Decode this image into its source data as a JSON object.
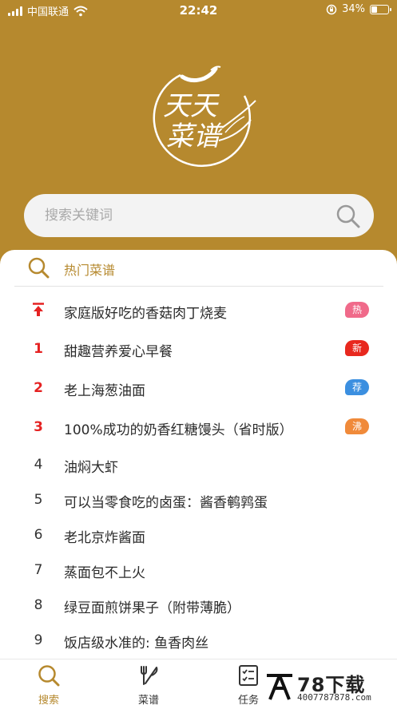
{
  "status_bar": {
    "carrier": "中国联通",
    "time": "22:42",
    "battery": "34%",
    "battery_level": 0.34
  },
  "logo": {
    "line1": "天天",
    "line2": "菜谱"
  },
  "search": {
    "placeholder": "搜索关键词",
    "icon": "search-icon"
  },
  "hot": {
    "title": "热门菜谱"
  },
  "recipes": [
    {
      "rank": "",
      "rank_icon": "pin-top-icon",
      "title": "家庭版好吃的香菇肉丁烧麦",
      "badge": "热",
      "badge_color": "#f06a8a"
    },
    {
      "rank": "1",
      "title": "甜趣营养爱心早餐",
      "badge": "新",
      "badge_color": "#e8281e"
    },
    {
      "rank": "2",
      "title": "老上海葱油面",
      "badge": "荐",
      "badge_color": "#3b8fe0"
    },
    {
      "rank": "3",
      "title": "100%成功的奶香红糖馒头（省时版）",
      "badge": "沸",
      "badge_color": "#f08a3a"
    },
    {
      "rank": "4",
      "title": "油焖大虾"
    },
    {
      "rank": "5",
      "title": "可以当零食吃的卤蛋：酱香鹌鹑蛋"
    },
    {
      "rank": "6",
      "title": "老北京炸酱面"
    },
    {
      "rank": "7",
      "title": "蒸面包不上火"
    },
    {
      "rank": "8",
      "title": "绿豆面煎饼果子（附带薄脆）"
    },
    {
      "rank": "9",
      "title": "饭店级水准的: 鱼香肉丝"
    }
  ],
  "tabs": [
    {
      "label": "搜索",
      "icon": "search-icon",
      "active": true
    },
    {
      "label": "菜谱",
      "icon": "fork-knife-icon"
    },
    {
      "label": "任务",
      "icon": "checklist-icon"
    }
  ],
  "watermark": {
    "text": "78下载",
    "sub": "4007787878.com"
  },
  "colors": {
    "brand": "#b6892e",
    "rank_red": "#e52222"
  }
}
